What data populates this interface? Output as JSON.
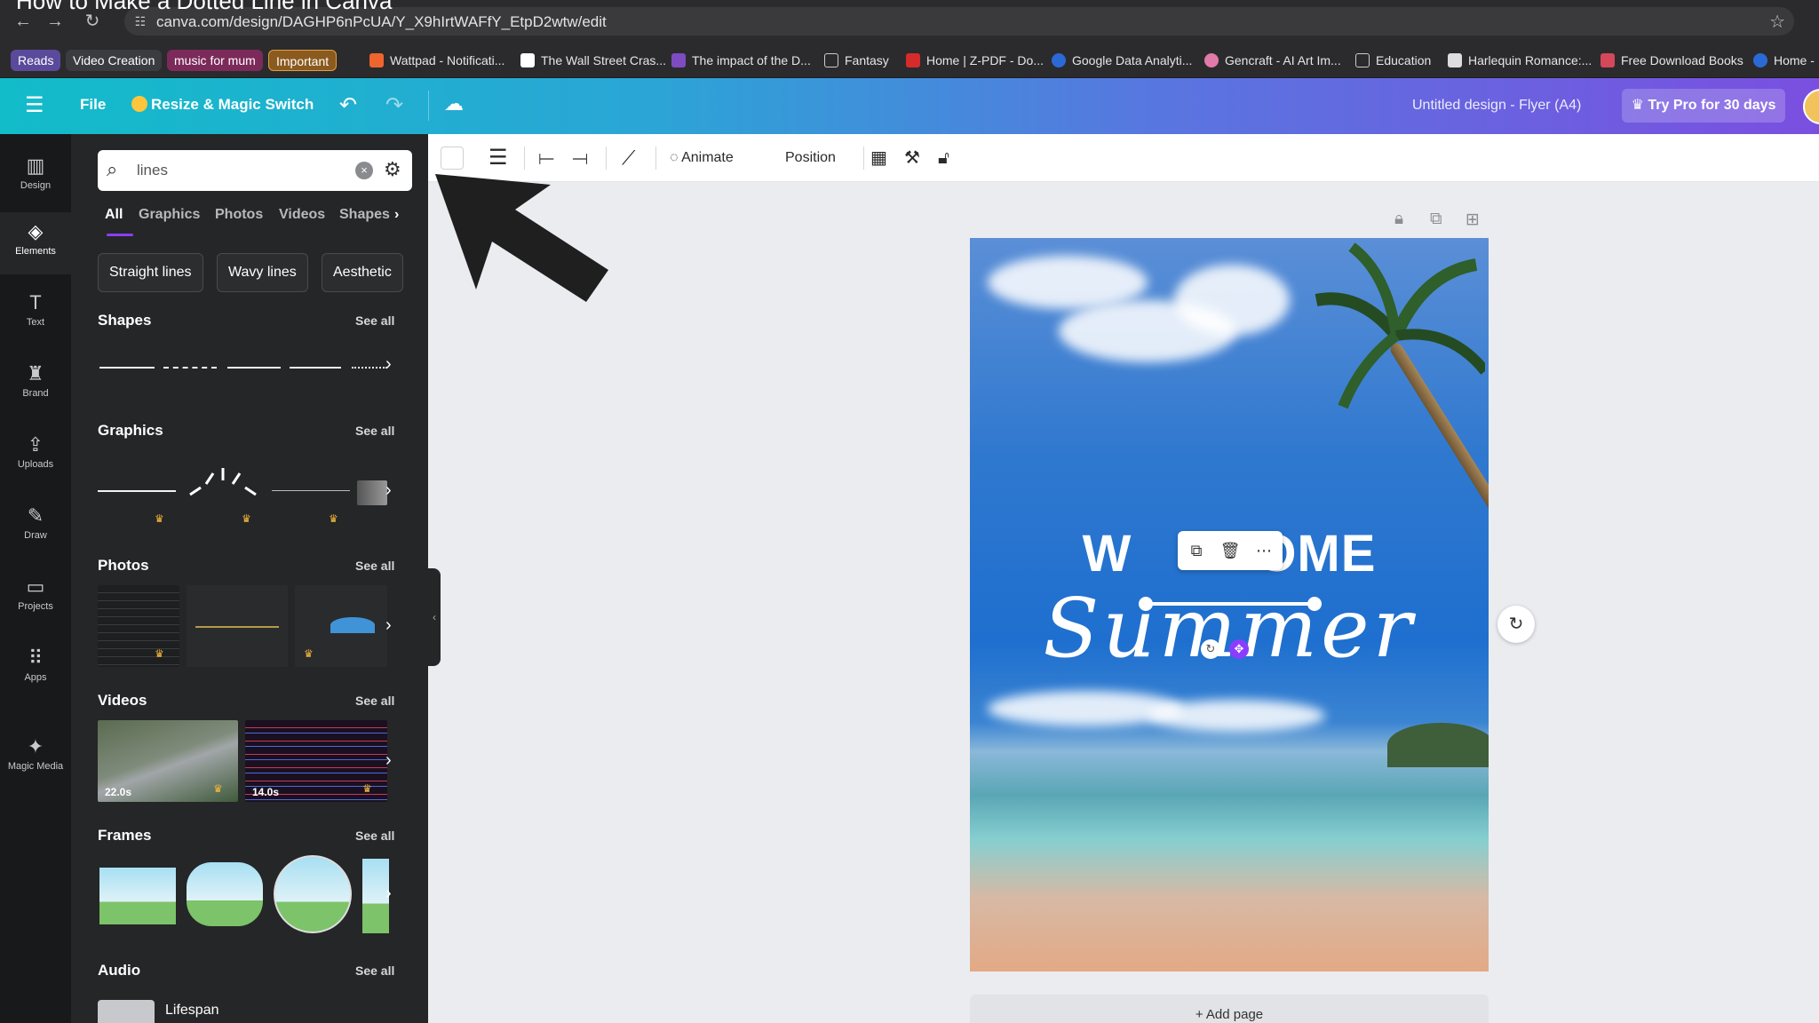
{
  "video_title": "How to Make a Dotted Line in Canva",
  "browser": {
    "url": "canva.com/design/DAGHP6nPcUA/Y_X9hIrtWAFfY_EtpD2wtw/edit",
    "bookmarks_chips": [
      "Reads",
      "Video Creation",
      "music for mum",
      "Important"
    ],
    "bookmarks": [
      "Wattpad - Notificati...",
      "The Wall Street Cras...",
      "The impact of the D...",
      "Fantasy",
      "Home | Z-PDF - Do...",
      "Google Data Analyti...",
      "Gencraft - AI Art Im...",
      "Education",
      "Harlequin Romance:...",
      "Free Download Books",
      "Home -"
    ]
  },
  "topbar": {
    "file": "File",
    "resize": "Resize & Magic Switch",
    "doc_title": "Untitled design - Flyer (A4)",
    "pro": "Try Pro for 30 days"
  },
  "rail": [
    "Design",
    "Elements",
    "Text",
    "Brand",
    "Uploads",
    "Draw",
    "Projects",
    "Apps",
    "Magic Media"
  ],
  "panel": {
    "search_value": "lines",
    "tabs": [
      "All",
      "Graphics",
      "Photos",
      "Videos",
      "Shapes"
    ],
    "chips": [
      "Straight lines",
      "Wavy lines",
      "Aesthetic"
    ],
    "see_all": "See all",
    "sections": {
      "shapes": "Shapes",
      "graphics": "Graphics",
      "photos": "Photos",
      "videos": "Videos",
      "frames": "Frames",
      "audio": "Audio"
    },
    "video_durations": [
      "22.0s",
      "14.0s"
    ],
    "audio_item": "Lifespan"
  },
  "toolbar": {
    "animate": "Animate",
    "position": "Position"
  },
  "design": {
    "welcome_left": "W",
    "welcome_right": "OME",
    "summer": "Summer"
  },
  "add_page": "+ Add page",
  "colors": {
    "accent": "#8b3dff",
    "header_start": "#12bcc9",
    "header_end": "#7a4fe0",
    "panel_bg": "#252627"
  }
}
